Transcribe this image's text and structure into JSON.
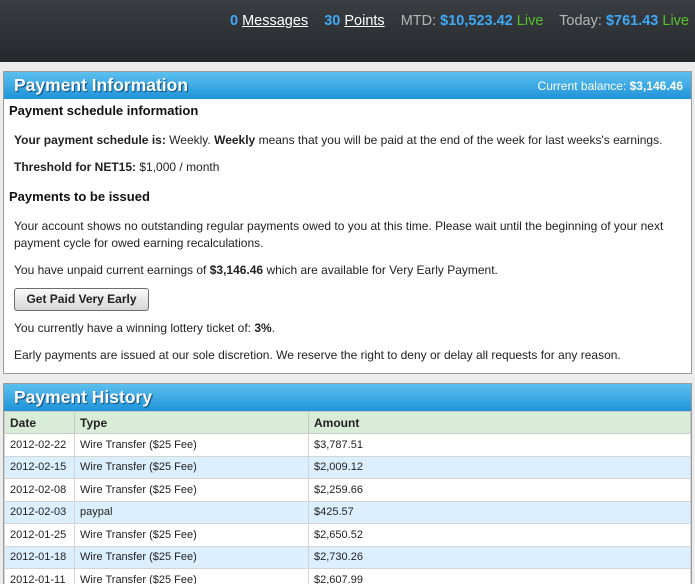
{
  "topbar": {
    "messages_count": "0",
    "messages_label": "Messages",
    "points_count": "30",
    "points_label": "Points",
    "mtd_label": "MTD:",
    "mtd_value": "$10,523.42",
    "mtd_status": "Live",
    "today_label": "Today:",
    "today_value": "$761.43",
    "today_status": "Live"
  },
  "payment_info": {
    "title": "Payment Information",
    "balance_label": "Current balance:",
    "balance_value": "$3,146.46",
    "schedule_heading": "Payment schedule information",
    "schedule_label": "Your payment schedule is:",
    "schedule_value": "Weekly.",
    "schedule_bold": "Weekly",
    "schedule_desc": "means that you will be paid at the end of the week for last weeks's earnings.",
    "threshold_label": "Threshold for NET15:",
    "threshold_value": "$1,000 / month",
    "issued_heading": "Payments to be issued",
    "outstanding_text": "Your account shows no outstanding regular payments owed to you at this time. Please wait until the beginning of your next payment cycle for owed earning recalculations.",
    "unpaid_prefix": "You have unpaid current earnings of",
    "unpaid_amount": "$3,146.46",
    "unpaid_suffix": "which are available for Very Early Payment.",
    "button_label": "Get Paid Very Early",
    "lottery_prefix": "You currently have a winning lottery ticket of:",
    "lottery_value": "3%",
    "lottery_suffix": ".",
    "discretion_text": "Early payments are issued at our sole discretion. We reserve the right to deny or delay all requests for any reason."
  },
  "payment_history": {
    "title": "Payment History",
    "columns": [
      "Date",
      "Type",
      "Amount"
    ],
    "rows": [
      [
        "2012-02-22",
        "Wire Transfer ($25 Fee)",
        "$3,787.51"
      ],
      [
        "2012-02-15",
        "Wire Transfer ($25 Fee)",
        "$2,009.12"
      ],
      [
        "2012-02-08",
        "Wire Transfer ($25 Fee)",
        "$2,259.66"
      ],
      [
        "2012-02-03",
        "paypal",
        "$425.57"
      ],
      [
        "2012-01-25",
        "Wire Transfer ($25 Fee)",
        "$2,650.52"
      ],
      [
        "2012-01-18",
        "Wire Transfer ($25 Fee)",
        "$2,730.26"
      ],
      [
        "2012-01-11",
        "Wire Transfer ($25 Fee)",
        "$2,607.99"
      ]
    ]
  },
  "colors": {
    "accent_blue": "#3fa9f5",
    "live_green": "#57c22c",
    "header_blue": "#1f93d8",
    "row_alt": "#dcefff",
    "table_header": "#d9ecd8"
  }
}
